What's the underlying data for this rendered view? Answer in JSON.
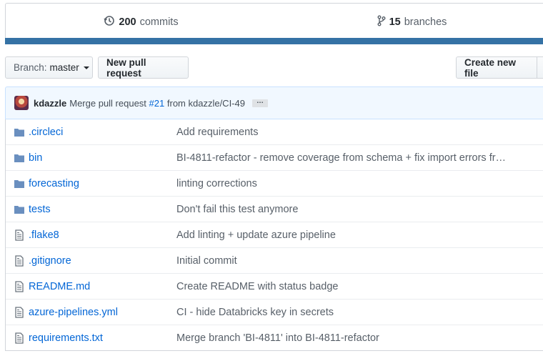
{
  "summary": {
    "commits": {
      "count": "200",
      "label": "commits"
    },
    "branches": {
      "count": "15",
      "label": "branches"
    },
    "language_bar_color": "#3572a5"
  },
  "toolbar": {
    "branch_prefix": "Branch:",
    "branch_name": "master",
    "new_pr_label": "New pull request",
    "create_file_label": "Create new file"
  },
  "latest_commit": {
    "author": "kdazzle",
    "message_prefix": "Merge pull request",
    "pr_ref": "#21",
    "message_suffix": "from kdazzle/CI-49",
    "ellipsis": "…"
  },
  "files": [
    {
      "name": ".circleci",
      "type": "dir",
      "icon": "folder-icon",
      "message": "Add requirements"
    },
    {
      "name": "bin",
      "type": "dir",
      "icon": "folder-icon",
      "message": "BI-4811-refactor - remove coverage from schema + fix import errors fr…"
    },
    {
      "name": "forecasting",
      "type": "dir",
      "icon": "folder-icon",
      "message": "linting corrections"
    },
    {
      "name": "tests",
      "type": "dir",
      "icon": "folder-icon",
      "message": "Don't fail this test anymore"
    },
    {
      "name": ".flake8",
      "type": "file",
      "icon": "file-icon",
      "message": "Add linting + update azure pipeline"
    },
    {
      "name": ".gitignore",
      "type": "file",
      "icon": "file-icon",
      "message": "Initial commit"
    },
    {
      "name": "README.md",
      "type": "file",
      "icon": "file-icon",
      "message": "Create README with status badge"
    },
    {
      "name": "azure-pipelines.yml",
      "type": "file",
      "icon": "file-icon",
      "message": "CI - hide Databricks key in secrets"
    },
    {
      "name": "requirements.txt",
      "type": "file",
      "icon": "file-icon",
      "message": "Merge branch 'BI-4811' into BI-4811-refactor"
    }
  ]
}
